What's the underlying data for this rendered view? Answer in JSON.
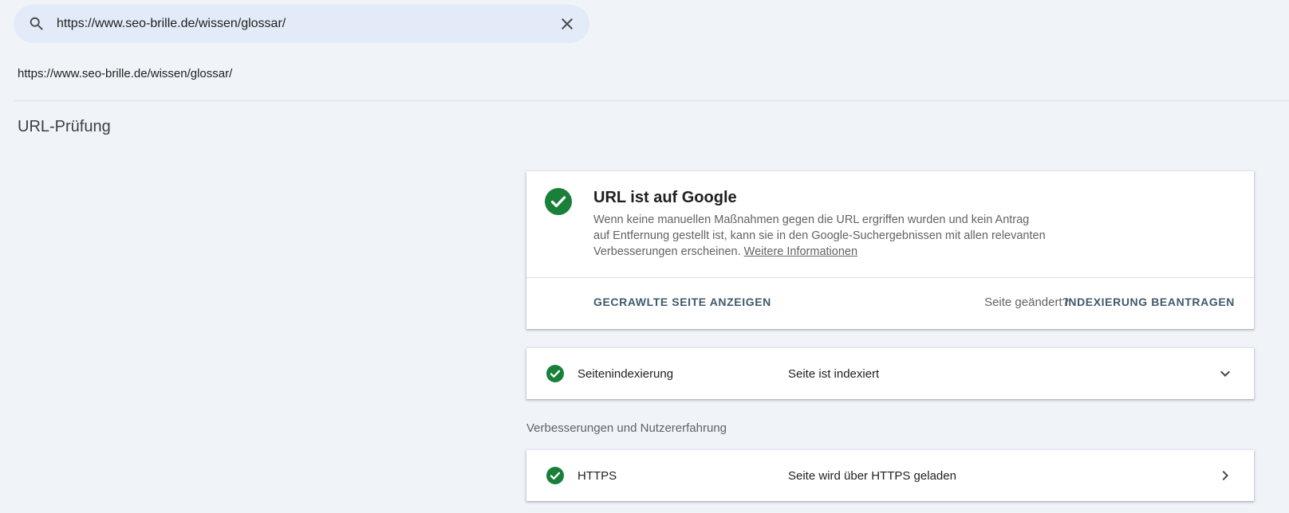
{
  "search": {
    "value": "https://www.seo-brille.de/wissen/glossar/",
    "icon": "search-icon",
    "clear_icon": "close-icon"
  },
  "inspected_url": "https://www.seo-brille.de/wissen/glossar/",
  "page_title": "URL-Prüfung",
  "status_card": {
    "icon": "check-circle-icon",
    "title": "URL ist auf Google",
    "description": "Wenn keine manuellen Maßnahmen gegen die URL ergriffen wurden und kein Antrag auf Entfernung gestellt ist, kann sie in den Google-Suchergebnissen mit allen relevanten Verbesserungen erscheinen.",
    "learn_more": "Weitere Informationen",
    "crawled_button": "GECRAWLTE SEITE ANZEIGEN",
    "changed_label": "Seite geändert?",
    "request_button": "INDEXIERUNG BEANTRAGEN"
  },
  "indexing_row": {
    "icon": "check-circle-icon",
    "label": "Seitenindexierung",
    "value": "Seite ist indexiert",
    "chevron": "chevron-down-icon"
  },
  "enhancements_label": "Verbesserungen und Nutzererfahrung",
  "https_row": {
    "icon": "check-circle-icon",
    "label": "HTTPS",
    "value": "Seite wird über HTTPS geladen",
    "chevron": "chevron-right-icon"
  },
  "colors": {
    "success": "#188038",
    "background": "#f0f4f9",
    "search_bg": "#e3ebf8",
    "button_text": "#3f5a6b"
  }
}
